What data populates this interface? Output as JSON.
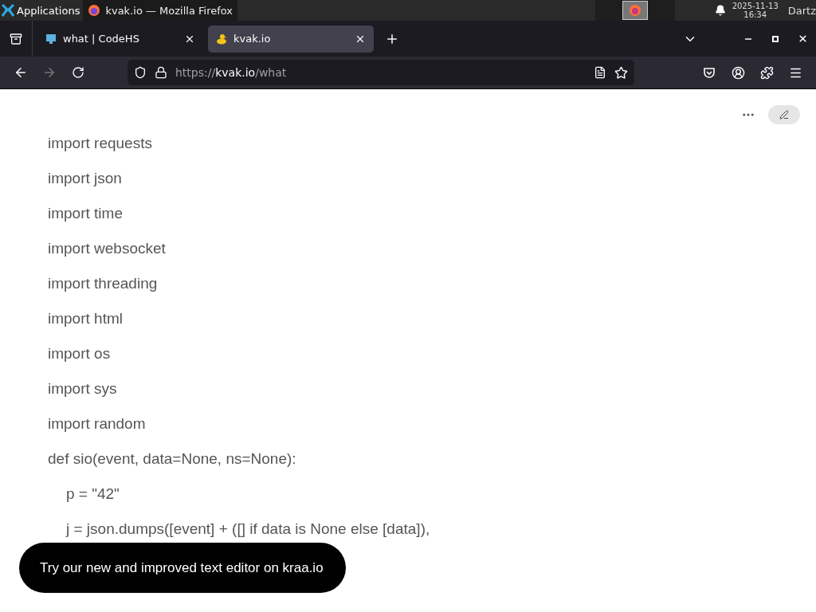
{
  "taskbar": {
    "apps_label": "Applications",
    "window_button": "kvak.io — Mozilla Firefox",
    "clock_date": "2025-11-13",
    "clock_time": "16:34",
    "user": "Dartz"
  },
  "tabs": [
    {
      "label": "what | CodeHS",
      "selected": false,
      "kind": "monitor"
    },
    {
      "label": "kvak.io",
      "selected": true,
      "kind": "duck"
    }
  ],
  "address_bar": {
    "scheme": "https://",
    "host": "kvak.io",
    "path": "/what"
  },
  "document": {
    "lines": [
      {
        "text": "import requests"
      },
      {
        "text": "import json"
      },
      {
        "text": "import time"
      },
      {
        "text": "import websocket"
      },
      {
        "text": "import threading"
      },
      {
        "text": "import html"
      },
      {
        "text": "import os"
      },
      {
        "text": "import sys"
      },
      {
        "text": "import random"
      },
      {
        "text": "def sio(event, data=None, ns=None):",
        "children": [
          {
            "text": "p = \"42\""
          },
          {
            "text": "j = json.dumps([event] + ([] if data is None else [data]),"
          }
        ]
      }
    ]
  },
  "toast": {
    "text": "Try our new and improved text editor on kraa.io"
  }
}
